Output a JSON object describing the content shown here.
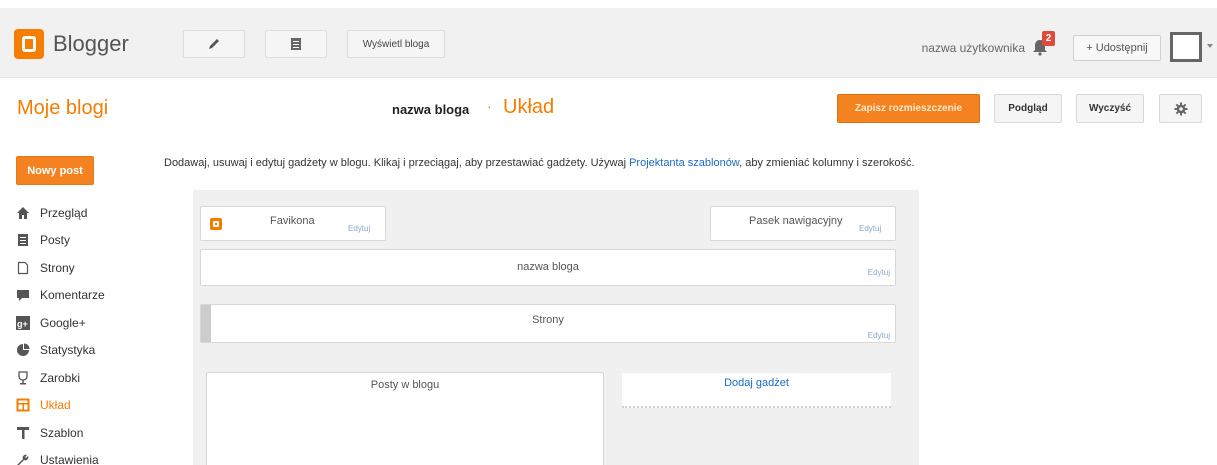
{
  "header": {
    "brand": "Blogger",
    "view_blog": "Wyświetl bloga",
    "username": "nazwa użytkownika",
    "notifications_count": "2",
    "share": "+ Udostępnij"
  },
  "subheader": {
    "my_blogs": "Moje blogi",
    "blog_name": "nazwa bloga",
    "separator": "·",
    "section": "Układ",
    "save_arrangement": "Zapisz rozmieszczenie",
    "preview": "Podgląd",
    "clear": "Wyczyść"
  },
  "sidebar": {
    "new_post": "Nowy post",
    "items": [
      {
        "label": "Przegląd",
        "icon": "home-icon"
      },
      {
        "label": "Posty",
        "icon": "posts-icon"
      },
      {
        "label": "Strony",
        "icon": "page-icon"
      },
      {
        "label": "Komentarze",
        "icon": "comment-icon"
      },
      {
        "label": "Google+",
        "icon": "google-plus-icon"
      },
      {
        "label": "Statystyka",
        "icon": "pie-chart-icon"
      },
      {
        "label": "Zarobki",
        "icon": "trophy-icon"
      },
      {
        "label": "Układ",
        "icon": "layout-icon",
        "active": true
      },
      {
        "label": "Szablon",
        "icon": "template-icon"
      },
      {
        "label": "Ustawienia",
        "icon": "wrench-icon"
      }
    ]
  },
  "main": {
    "desc_before": "Dodawaj, usuwaj i edytuj gadżety w blogu. Klikaj i przeciągaj, aby przestawiać gadżety. Używaj ",
    "desc_link": "Projektanta szablonów",
    "desc_after": ", aby zmieniać kolumny i szerokość.",
    "gadgets": {
      "favicon": {
        "title": "Favikona",
        "edit": "Edytuj"
      },
      "navbar": {
        "title": "Pasek nawigacyjny",
        "edit": "Edytuj"
      },
      "blog_header": {
        "title": "nazwa bloga",
        "edit": "Edytuj"
      },
      "pages": {
        "title": "Strony",
        "edit": "Edytuj"
      },
      "blog_posts": {
        "title": "Posty w blogu"
      },
      "add_gadget": "Dodaj gadżet"
    }
  },
  "colors": {
    "accent": "#f57d00",
    "link": "#1a6bc4"
  }
}
